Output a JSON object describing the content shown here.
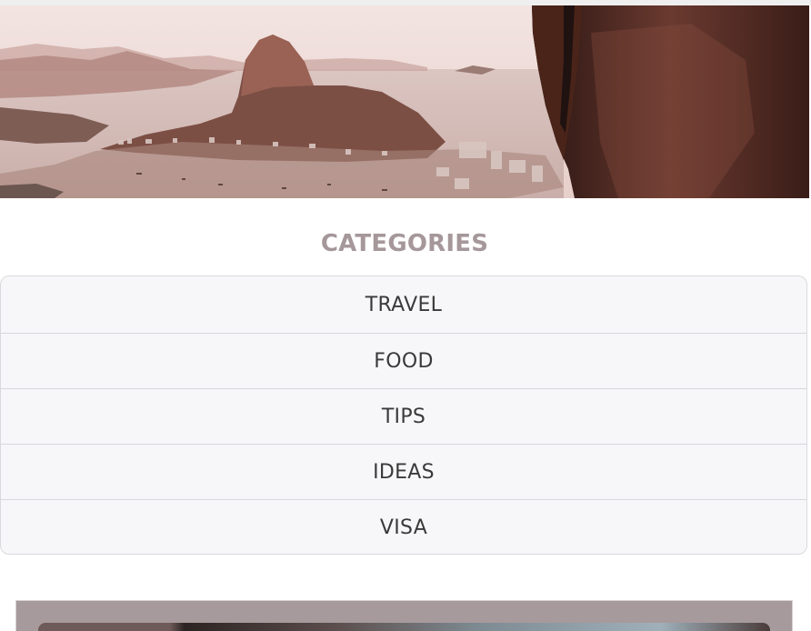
{
  "hero": {
    "image_description": "scenic"
  },
  "categories": {
    "title": "CATEGORIES",
    "items": [
      {
        "label": "TRAVEL"
      },
      {
        "label": "FOOD"
      },
      {
        "label": "TIPS"
      },
      {
        "label": "IDEAS"
      },
      {
        "label": "VISA"
      }
    ]
  },
  "colors": {
    "title": "#a5979a",
    "list_background": "#f7f7f9",
    "list_border": "#d9dadd",
    "item_text": "#3a3a3a",
    "card_background": "#a79a9c"
  }
}
